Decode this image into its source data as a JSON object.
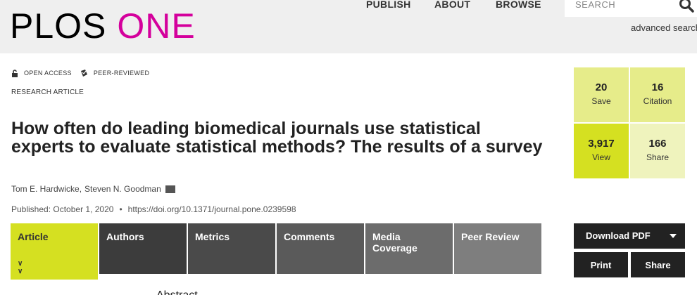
{
  "header": {
    "logo_part1": "PLOS",
    "logo_part2": "ONE",
    "nav": [
      "PUBLISH",
      "ABOUT",
      "BROWSE"
    ],
    "search_placeholder": "SEARCH",
    "advanced_search": "advanced search"
  },
  "badges": {
    "open_access": "OPEN ACCESS",
    "peer_reviewed": "PEER-REVIEWED"
  },
  "article": {
    "type": "RESEARCH ARTICLE",
    "title": "How often do leading biomedical journals use statistical experts to evaluate statistical methods? The results of a survey",
    "authors": [
      "Tom E. Hardwicke,",
      "Steven N. Goodman"
    ],
    "published": "Published: October 1, 2020",
    "doi": "https://doi.org/10.1371/journal.pone.0239598",
    "abstract_heading": "Abstract"
  },
  "tabs": [
    "Article",
    "Authors",
    "Metrics",
    "Comments",
    "Media Coverage",
    "Peer Review"
  ],
  "metrics": {
    "save": {
      "value": "20",
      "label": "Save"
    },
    "citation": {
      "value": "16",
      "label": "Citation"
    },
    "view": {
      "value": "3,917",
      "label": "View"
    },
    "share": {
      "value": "166",
      "label": "Share"
    }
  },
  "actions": {
    "download": "Download PDF",
    "print": "Print",
    "share": "Share"
  },
  "colors": {
    "brand_magenta": "#d4009c",
    "accent_green": "#d5e021"
  }
}
